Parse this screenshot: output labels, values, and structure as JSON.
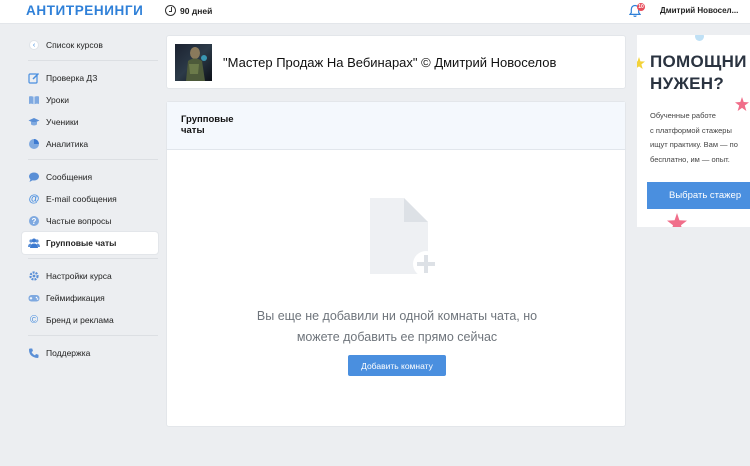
{
  "header": {
    "logo": "АНТИТРЕНИНГИ",
    "days": "90 дней",
    "notifications_count": "10",
    "user_name": "Дмитрий Новосел..."
  },
  "sidebar": {
    "back": "Список курсов",
    "group1": [
      "Проверка ДЗ",
      "Уроки",
      "Ученики",
      "Аналитика"
    ],
    "group2": [
      "Сообщения",
      "E-mail сообщения",
      "Частые вопросы",
      "Групповые чаты"
    ],
    "group3": [
      "Настройки курса",
      "Геймификация",
      "Бренд и реклама"
    ],
    "group4": [
      "Поддержка"
    ],
    "active": "Групповые чаты"
  },
  "course": {
    "title": "\"Мастер Продаж На Вебинарах\" © Дмитрий Новоселов"
  },
  "panel": {
    "title_line1": "Групповые",
    "title_line2": "чаты",
    "empty_line1": "Вы еще не добавили ни одной комнаты чата, но",
    "empty_line2": "можете добавить ее прямо сейчас",
    "add_button": "Добавить комнату"
  },
  "promo": {
    "title_line1": "ПОМОЩНИ",
    "title_line2": "НУЖЕН?",
    "text_line1": "Обученные работе",
    "text_line2": "с платформой стажеры",
    "text_line3": "ищут практику. Вам — по",
    "text_line4": "бесплатно, им — опыт.",
    "button": "Выбрать стажер"
  },
  "colors": {
    "accent": "#2f80d8",
    "button": "#4a8fdf",
    "badge": "#e74c5a",
    "background": "#eceef1"
  }
}
